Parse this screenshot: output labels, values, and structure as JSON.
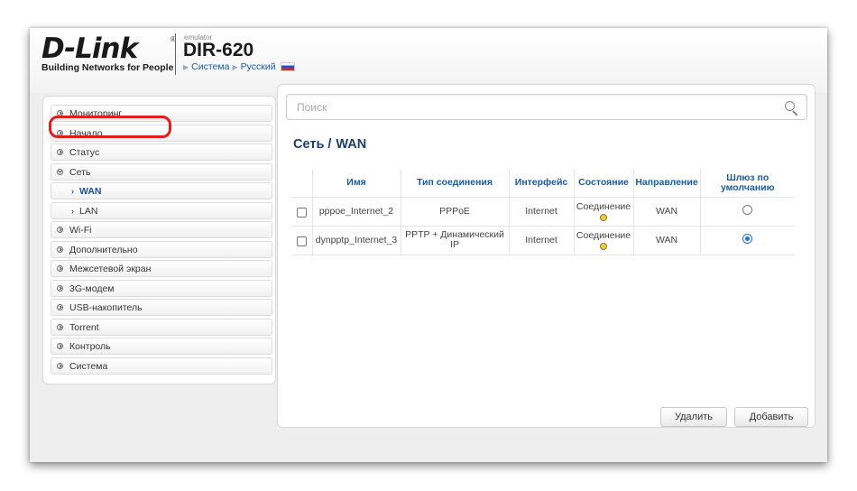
{
  "header": {
    "logo_text": "D-Link",
    "logo_reg": "®",
    "logo_tagline": "Building Networks for People",
    "emulator_label": "emulator",
    "model": "DIR-620",
    "crumb_system": "Система",
    "crumb_language": "Русский"
  },
  "sidebar": {
    "items": [
      {
        "label": "Мониторинг"
      },
      {
        "label": "Начало"
      },
      {
        "label": "Статус"
      },
      {
        "label": "Сеть"
      },
      {
        "label": "WAN"
      },
      {
        "label": "LAN"
      },
      {
        "label": "Wi-Fi"
      },
      {
        "label": "Дополнительно"
      },
      {
        "label": "Межсетевой экран"
      },
      {
        "label": "3G-модем"
      },
      {
        "label": "USB-накопитель"
      },
      {
        "label": "Torrent"
      },
      {
        "label": "Контроль"
      },
      {
        "label": "Система"
      }
    ]
  },
  "search": {
    "placeholder": "Поиск"
  },
  "page": {
    "title_section": "Сеть",
    "title_sep": "/",
    "title_page": "WAN"
  },
  "table": {
    "headers": [
      "Имя",
      "Тип соединения",
      "Интерфейс",
      "Состояние",
      "Направление",
      "Шлюз по умолчанию"
    ],
    "rows": [
      {
        "name": "pppoe_Internet_2",
        "type": "PPPoE",
        "iface": "Internet",
        "state": "Соединение",
        "direction": "WAN",
        "default_gw": false
      },
      {
        "name": "dynpptp_Internet_3",
        "type": "PPTP + Динамический IP",
        "iface": "Internet",
        "state": "Соединение",
        "direction": "WAN",
        "default_gw": true
      }
    ]
  },
  "buttons": {
    "delete": "Удалить",
    "add": "Добавить"
  },
  "colors": {
    "accent": "#1a5a9c",
    "highlight": "#e01e1e",
    "status_dot": "#f3cf15"
  }
}
